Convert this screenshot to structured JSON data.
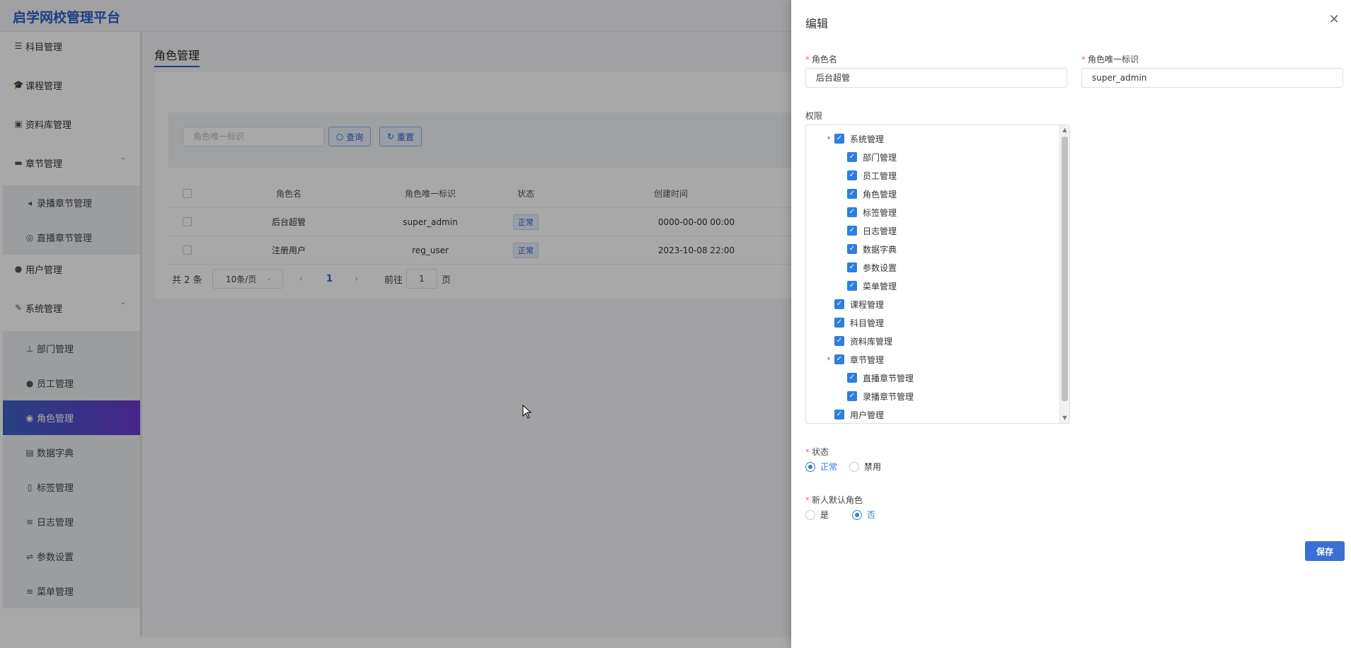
{
  "app": {
    "title": "启学网校管理平台"
  },
  "sidebar": {
    "items": [
      {
        "label": "科目管理",
        "icon": "list-icon"
      },
      {
        "label": "课程管理",
        "icon": "graduation-cap-icon"
      },
      {
        "label": "资料库管理",
        "icon": "briefcase-icon"
      },
      {
        "label": "章节管理",
        "icon": "folder-icon",
        "expanded": true
      },
      {
        "label": "录播章节管理",
        "icon": "play-icon"
      },
      {
        "label": "直播章节管理",
        "icon": "live-icon"
      },
      {
        "label": "用户管理",
        "icon": "users-icon"
      },
      {
        "label": "系统管理",
        "icon": "wrench-icon",
        "expanded": true
      },
      {
        "label": "部门管理",
        "icon": "org-chart-icon"
      },
      {
        "label": "员工管理",
        "icon": "user-icon"
      },
      {
        "label": "角色管理",
        "icon": "role-icon",
        "active": true
      },
      {
        "label": "数据字典",
        "icon": "dictionary-icon"
      },
      {
        "label": "标签管理",
        "icon": "tag-icon"
      },
      {
        "label": "日志管理",
        "icon": "log-icon"
      },
      {
        "label": "参数设置",
        "icon": "sliders-icon"
      },
      {
        "label": "菜单管理",
        "icon": "menu-list-icon"
      }
    ]
  },
  "main": {
    "page_title": "角色管理",
    "search": {
      "placeholder": "角色唯一标识",
      "query_label": "查询",
      "reset_label": "重置"
    },
    "table": {
      "columns": [
        "角色名",
        "角色唯一标识",
        "状态",
        "创建时间"
      ],
      "rows": [
        {
          "name": "后台超管",
          "key": "super_admin",
          "status": "正常",
          "created": "0000-00-00 00:00"
        },
        {
          "name": "注册用户",
          "key": "reg_user",
          "status": "正常",
          "created": "2023-10-08 22:00"
        }
      ]
    },
    "pager": {
      "total": "共 2 条",
      "page_size": "10条/页",
      "current": "1",
      "goto_prefix": "前往",
      "goto_value": "1",
      "goto_suffix": "页"
    }
  },
  "drawer": {
    "title": "编辑",
    "role_name_label": "角色名",
    "role_name_value": "后台超管",
    "role_key_label": "角色唯一标识",
    "role_key_value": "super_admin",
    "permission_label": "权限",
    "tree": [
      {
        "label": "系统管理",
        "level": 1,
        "expandable": true
      },
      {
        "label": "部门管理",
        "level": 2
      },
      {
        "label": "员工管理",
        "level": 2
      },
      {
        "label": "角色管理",
        "level": 2
      },
      {
        "label": "标签管理",
        "level": 2
      },
      {
        "label": "日志管理",
        "level": 2
      },
      {
        "label": "数据字典",
        "level": 2
      },
      {
        "label": "参数设置",
        "level": 2
      },
      {
        "label": "菜单管理",
        "level": 2
      },
      {
        "label": "课程管理",
        "level": 1
      },
      {
        "label": "科目管理",
        "level": 1
      },
      {
        "label": "资料库管理",
        "level": 1
      },
      {
        "label": "章节管理",
        "level": 1,
        "expandable": true
      },
      {
        "label": "直播章节管理",
        "level": 2
      },
      {
        "label": "录播章节管理",
        "level": 2
      },
      {
        "label": "用户管理",
        "level": 1
      }
    ],
    "status_label": "状态",
    "status_options": [
      "正常",
      "禁用"
    ],
    "status_selected": "正常",
    "default_role_label": "新人默认角色",
    "default_role_options": [
      "是",
      "否"
    ],
    "default_role_selected": "否",
    "save_label": "保存"
  },
  "colors": {
    "primary": "#2d5fc4",
    "checkbox": "#2d7fe0",
    "active_gradient_start": "#3e62c4",
    "active_gradient_end": "#6a3ad0",
    "required": "#f56c6c"
  }
}
